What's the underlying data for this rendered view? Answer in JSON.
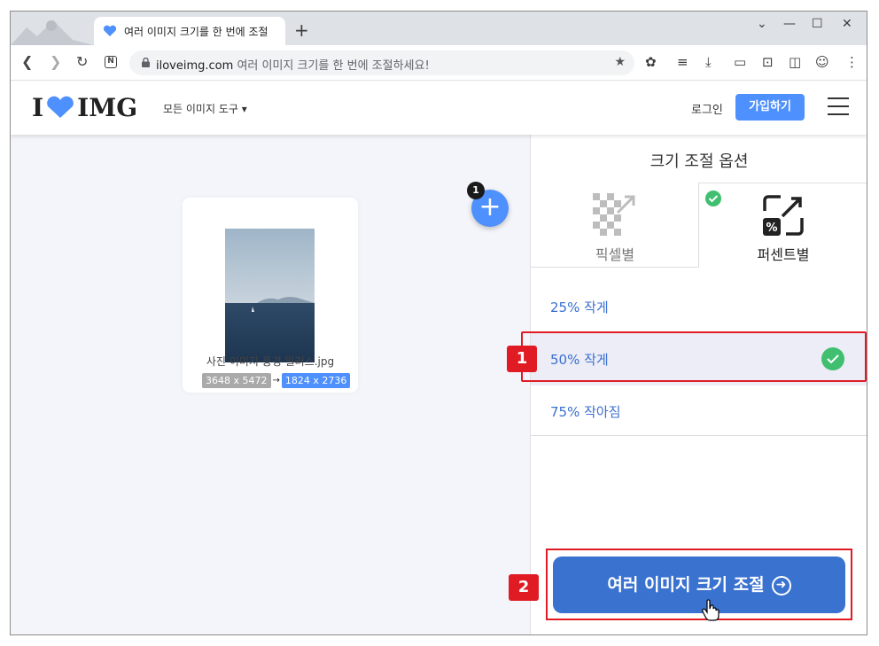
{
  "browser": {
    "tab_title": "여러 이미지 크기를 한 번에 조절",
    "new_tab": "+",
    "url_site": "iloveimg.com",
    "url_rest": "여러 이미지 크기를 한 번에 조절하세요!",
    "window_controls": [
      "⌄",
      "—",
      "☐",
      "✕"
    ]
  },
  "site": {
    "logo_left": "I",
    "logo_right": "IMG",
    "all_tools": "모든 이미지 도구 ▾",
    "login": "로그인",
    "signup": "가입하기"
  },
  "workspace": {
    "file_name": "사진 이미지 풍경 일러스.jpg",
    "dim_old": "3648 x 5472",
    "dim_arrow": "→",
    "dim_new": "1824 x 2736",
    "add_badge": "1",
    "add_symbol": "+"
  },
  "sidebar": {
    "title": "크기 조절 옵션",
    "option_pixel": "픽셀별",
    "option_percent": "퍼센트별",
    "rows": [
      "25% 작게",
      "50% 작게",
      "75% 작아짐"
    ],
    "selected_row": 1,
    "resize_button": "여러 이미지 크기 조절"
  },
  "annotations": {
    "step1": "1",
    "step2": "2"
  },
  "colors": {
    "accent": "#4d90fe",
    "button": "#3a72d0",
    "highlight": "#e01b24",
    "check": "#3fbf6f"
  }
}
